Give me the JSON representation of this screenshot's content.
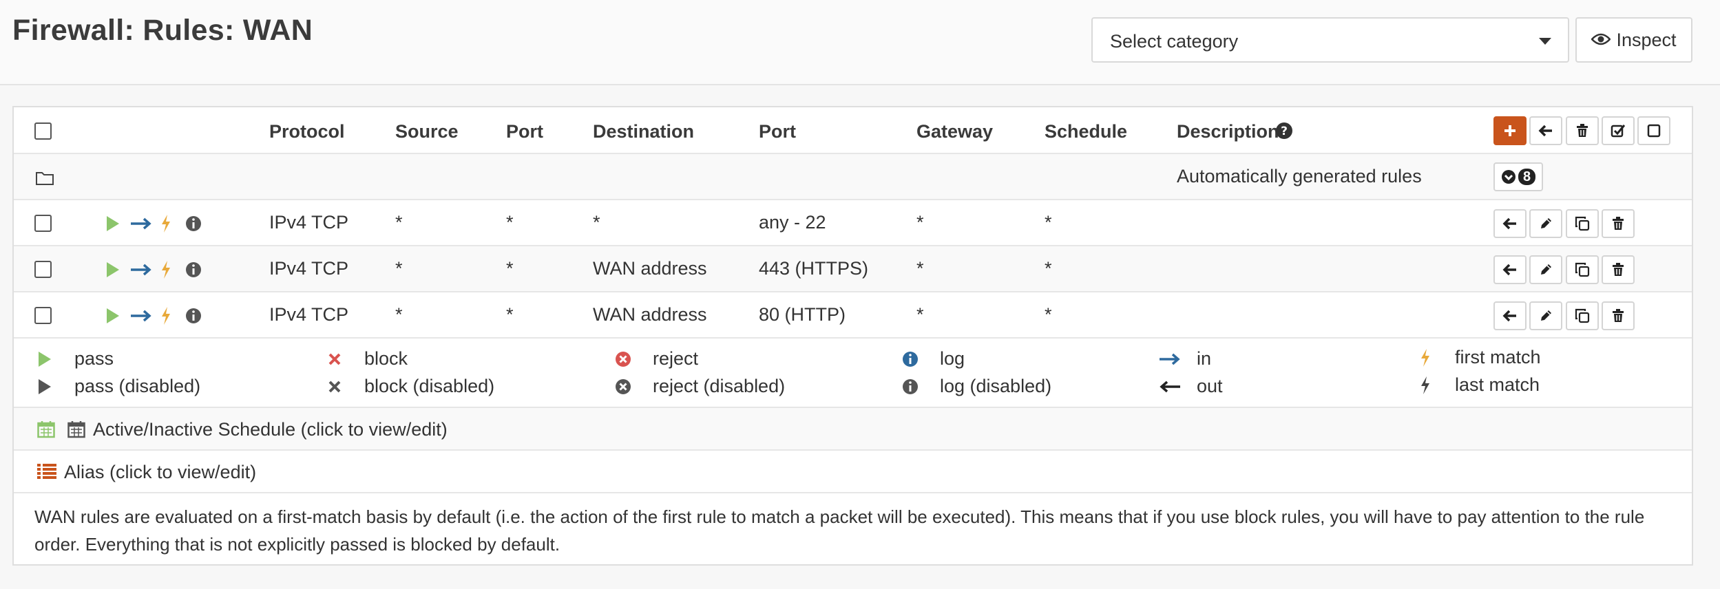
{
  "page": {
    "title": "Firewall: Rules: WAN",
    "category_select": "Select category",
    "inspect_label": "Inspect"
  },
  "table": {
    "headers": {
      "protocol": "Protocol",
      "source": "Source",
      "source_port": "Port",
      "destination": "Destination",
      "dest_port": "Port",
      "gateway": "Gateway",
      "schedule": "Schedule",
      "description": "Description"
    },
    "auto_group": {
      "label": "Automatically generated rules",
      "count": "8"
    },
    "rules": [
      {
        "protocol": "IPv4 TCP",
        "source": "*",
        "source_port": "*",
        "destination": "*",
        "dest_port": "any - 22",
        "gateway": "*",
        "schedule": "*",
        "description": ""
      },
      {
        "protocol": "IPv4 TCP",
        "source": "*",
        "source_port": "*",
        "destination": "WAN address",
        "dest_port": "443 (HTTPS)",
        "gateway": "*",
        "schedule": "*",
        "description": ""
      },
      {
        "protocol": "IPv4 TCP",
        "source": "*",
        "source_port": "*",
        "destination": "WAN address",
        "dest_port": "80 (HTTP)",
        "gateway": "*",
        "schedule": "*",
        "description": ""
      }
    ]
  },
  "legend": {
    "pass": "pass",
    "pass_disabled": "pass (disabled)",
    "block": "block",
    "block_disabled": "block (disabled)",
    "reject": "reject",
    "reject_disabled": "reject (disabled)",
    "log": "log",
    "log_disabled": "log (disabled)",
    "in": "in",
    "out": "out",
    "first_match": "first match",
    "last_match": "last match"
  },
  "schedule_note": "Active/Inactive Schedule (click to view/edit)",
  "alias_note": "Alias (click to view/edit)",
  "footer": "WAN rules are evaluated on a first-match basis by default (i.e. the action of the first rule to match a packet will be executed). This means that if you use block rules, you will have to pay attention to the rule order. Everything that is not explicitly passed is blocked by default.",
  "colors": {
    "accent": "#c9541c",
    "pass": "#8cc56b",
    "block": "#d9534f",
    "log": "#2e6a9e",
    "lightning": "#e8a93a"
  }
}
